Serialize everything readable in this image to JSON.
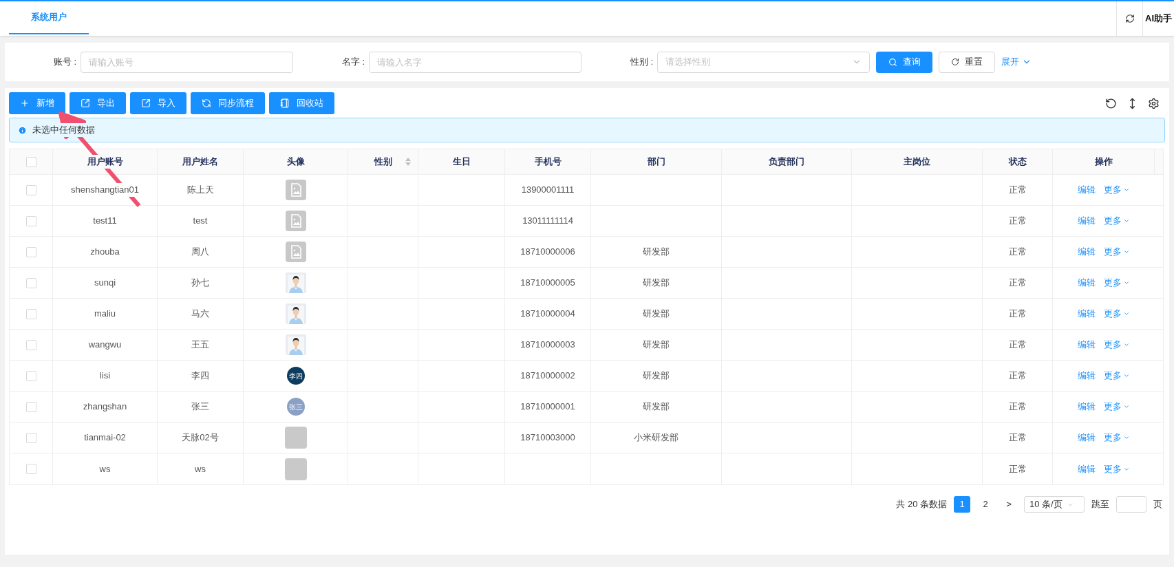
{
  "tabs": [
    {
      "label": "系统用户",
      "selected": true
    }
  ],
  "header_right": {
    "assistant": "AI助手"
  },
  "filters": [
    {
      "label": "账号 :",
      "placeholder": "请输入账号",
      "kind": "input"
    },
    {
      "label": "名字 :",
      "placeholder": "请输入名字",
      "kind": "input"
    },
    {
      "label": "性别 :",
      "placeholder": "请选择性别",
      "kind": "select"
    }
  ],
  "filter_buttons": {
    "search": "查询",
    "reset": "重置",
    "expand": "展开"
  },
  "toolbar": [
    {
      "label": "新增"
    },
    {
      "label": "导出"
    },
    {
      "label": "导入"
    },
    {
      "label": "同步流程"
    },
    {
      "label": "回收站"
    }
  ],
  "alert": "未选中任何数据",
  "table": {
    "all_checked": false,
    "columns": [
      {
        "label": "用户账号",
        "sortable": false
      },
      {
        "label": "用户姓名",
        "sortable": false
      },
      {
        "label": "头像",
        "sortable": false
      },
      {
        "label": "性别",
        "sortable": true
      },
      {
        "label": "生日",
        "sortable": false
      },
      {
        "label": "手机号",
        "sortable": false
      },
      {
        "label": "部门",
        "sortable": false
      },
      {
        "label": "负责部门",
        "sortable": false
      },
      {
        "label": "主岗位",
        "sortable": false
      },
      {
        "label": "状态",
        "sortable": false
      },
      {
        "label": "操作",
        "sortable": false
      }
    ],
    "rows": [
      {
        "checked": false,
        "account": "shenshangtian01",
        "name": "陈上天",
        "avatar": {
          "kind": "broken"
        },
        "phone": "13900001111",
        "status": "正常",
        "edit": "编辑",
        "more": "更多"
      },
      {
        "checked": false,
        "account": "test11",
        "name": "test",
        "avatar": {
          "kind": "broken"
        },
        "phone": "13011111114",
        "status": "正常",
        "edit": "编辑",
        "more": "更多"
      },
      {
        "checked": false,
        "account": "zhouba",
        "name": "周八",
        "avatar": {
          "kind": "broken"
        },
        "phone": "18710000006",
        "dept": "研发部",
        "status": "正常",
        "edit": "编辑",
        "more": "更多"
      },
      {
        "checked": false,
        "account": "sunqi",
        "name": "孙七",
        "phone": "18710000005",
        "dept": "研发部",
        "status": "正常",
        "edit": "编辑",
        "more": "更多"
      },
      {
        "checked": false,
        "account": "maliu",
        "name": "马六",
        "phone": "18710000004",
        "dept": "研发部",
        "status": "正常",
        "edit": "编辑",
        "more": "更多"
      },
      {
        "checked": false,
        "account": "wangwu",
        "name": "王五",
        "phone": "18710000003",
        "dept": "研发部",
        "status": "正常",
        "edit": "编辑",
        "more": "更多"
      },
      {
        "checked": false,
        "account": "lisi",
        "name": "李四",
        "avatar": {
          "kind": "initials",
          "text": "李四",
          "color": "#0d3c5e"
        },
        "phone": "18710000002",
        "dept": "研发部",
        "status": "正常",
        "edit": "编辑",
        "more": "更多"
      },
      {
        "checked": false,
        "account": "zhangshan",
        "name": "张三",
        "avatar": {
          "kind": "initials",
          "text": "张三",
          "color": "#8aa0c4"
        },
        "phone": "18710000001",
        "dept": "研发部",
        "status": "正常",
        "edit": "编辑",
        "more": "更多"
      },
      {
        "checked": false,
        "account": "tianmai-02",
        "name": "天脉02号",
        "avatar": {
          "kind": "blank"
        },
        "phone": "18710003000",
        "dept": "小米研发部",
        "status": "正常",
        "edit": "编辑",
        "more": "更多"
      },
      {
        "checked": false,
        "account": "ws",
        "name": "ws",
        "avatar": {
          "kind": "blank"
        },
        "status": "正常",
        "edit": "编辑",
        "more": "更多"
      }
    ]
  },
  "pagination": {
    "total": "共 20 条数据",
    "pages": [
      {
        "label": "1",
        "selected": true
      },
      {
        "label": "2",
        "selected": false
      }
    ],
    "next": ">",
    "page_size": "10 条/页",
    "jump_label": "跳至",
    "page_unit": "页"
  }
}
